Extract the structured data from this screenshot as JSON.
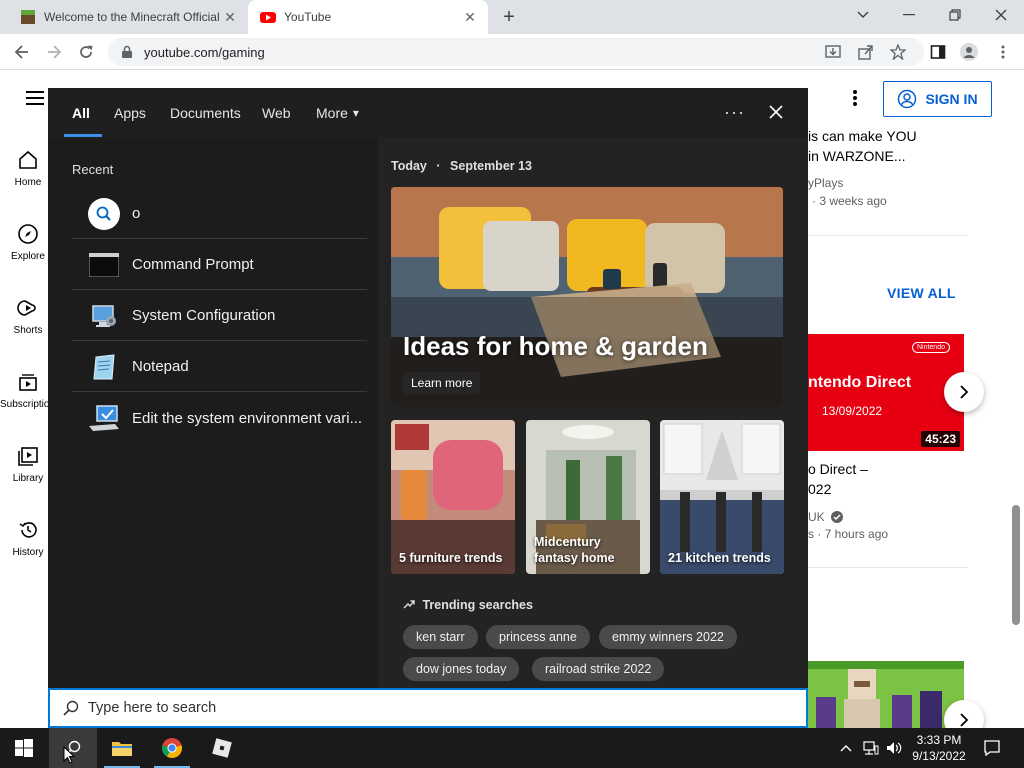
{
  "browser": {
    "tabs": [
      {
        "title": "Welcome to the Minecraft Official",
        "close": "✕"
      },
      {
        "title": "YouTube",
        "close": "✕"
      }
    ],
    "new_tab": "+",
    "url": "youtube.com/gaming"
  },
  "youtube": {
    "sidebar": [
      {
        "label": "Home"
      },
      {
        "label": "Explore"
      },
      {
        "label": "Shorts"
      },
      {
        "label": "Subscriptions"
      },
      {
        "label": "Library"
      },
      {
        "label": "History"
      }
    ],
    "sign_in": "SIGN IN",
    "video1": {
      "title_line1": "is can make YOU",
      "title_line2": "in WARZONE...",
      "channel": "yPlays",
      "meta": "· 3 weeks ago"
    },
    "view_all": "VIEW ALL",
    "video2": {
      "thumb_text": "ntendo Direct",
      "thumb_date": "13/09/2022",
      "thumb_badge": "Nintendo",
      "duration": "45:23",
      "title_line1": "o Direct –",
      "title_line2": "022",
      "channel": "UK",
      "meta": "s · 7 hours ago"
    }
  },
  "search": {
    "tabs": [
      "All",
      "Apps",
      "Documents",
      "Web",
      "More"
    ],
    "more_arrow": "▾",
    "dots": "···",
    "recent_heading": "Recent",
    "recent": [
      {
        "label": "o",
        "icon": "search-icon"
      },
      {
        "label": "Command Prompt",
        "icon": "command-prompt-icon"
      },
      {
        "label": "System Configuration",
        "icon": "system-configuration-icon"
      },
      {
        "label": "Notepad",
        "icon": "notepad-icon"
      },
      {
        "label": "Edit the system environment vari...",
        "icon": "system-properties-icon"
      }
    ],
    "today_label": "Today",
    "today_sep": "·",
    "today_date": "September 13",
    "hero": {
      "title": "Ideas for home & garden",
      "button": "Learn more"
    },
    "cards": [
      {
        "label": "5 furniture trends"
      },
      {
        "label": "Midcentury fantasy home"
      },
      {
        "label": "21 kitchen trends"
      }
    ],
    "trending_heading": "Trending searches",
    "trending": [
      "ken starr",
      "princess anne",
      "emmy winners 2022",
      "dow jones today",
      "railroad strike 2022"
    ],
    "box_placeholder": "Type here to search"
  },
  "taskbar": {
    "time": "3:33 PM",
    "date": "9/13/2022"
  },
  "colors": {
    "accent": "#0078d7",
    "youtube_red": "#ff0000",
    "youtube_blue": "#065fd4",
    "flyout_bg": "#202020"
  }
}
